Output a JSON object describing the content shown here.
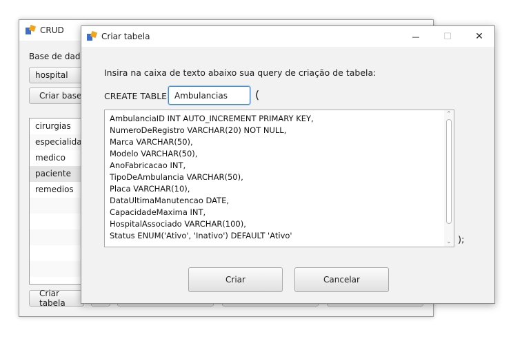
{
  "crud_window": {
    "title": "CRUD",
    "database_label": "Base de dados",
    "database_selected": "hospital",
    "create_db_button": "Criar base",
    "create_table_button": "Criar tabela",
    "tables": [
      "cirurgias",
      "especialidade",
      "medico",
      "paciente",
      "remedios"
    ],
    "selected_table": "paciente"
  },
  "dialog": {
    "title": "Criar tabela",
    "minimize_glyph": "—",
    "maximize_glyph": "☐",
    "close_glyph": "✕",
    "instruction": "Insira na caixa de texto abaixo sua query de criação de tabela:",
    "create_table_prefix": "CREATE TABLE",
    "table_name_value": "Ambulancias",
    "open_paren": "(",
    "close_paren": ");",
    "query_lines": [
      "AmbulanciaID INT AUTO_INCREMENT PRIMARY KEY,",
      "NumeroDeRegistro VARCHAR(20) NOT NULL,",
      "Marca VARCHAR(50),",
      "Modelo VARCHAR(50),",
      "AnoFabricacao INT,",
      "TipoDeAmbulancia VARCHAR(50),",
      "Placa VARCHAR(10),",
      "DataUltimaManutencao DATE,",
      "CapacidadeMaxima INT,",
      "HospitalAssociado VARCHAR(100),",
      "Status ENUM('Ativo', 'Inativo') DEFAULT 'Ativo'"
    ],
    "confirm_button": "Criar",
    "cancel_button": "Cancelar"
  },
  "colors": {
    "window_bg": "#f2f2f2",
    "focus_border": "#3c8ad6",
    "selected_row": "#e4e4e4"
  }
}
